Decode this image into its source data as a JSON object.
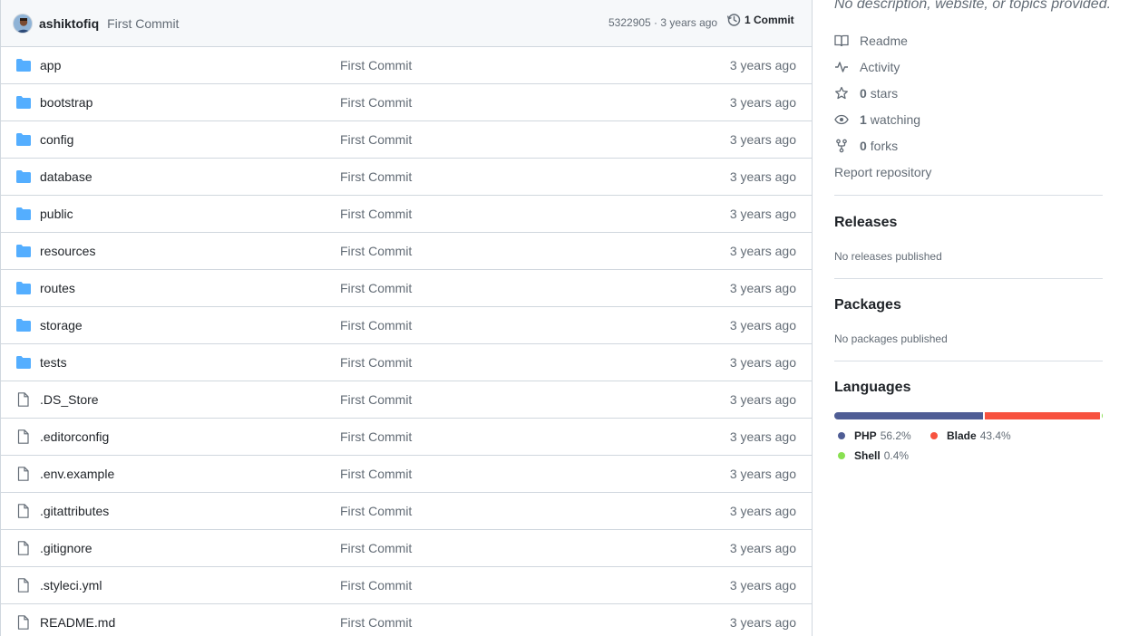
{
  "commit": {
    "author": "ashiktofiq",
    "message": "First Commit",
    "meta": "5322905 · 3 years ago",
    "count_label": "1 Commit"
  },
  "files": [
    {
      "name": "app",
      "type": "folder",
      "message": "First Commit",
      "age": "3 years ago"
    },
    {
      "name": "bootstrap",
      "type": "folder",
      "message": "First Commit",
      "age": "3 years ago"
    },
    {
      "name": "config",
      "type": "folder",
      "message": "First Commit",
      "age": "3 years ago"
    },
    {
      "name": "database",
      "type": "folder",
      "message": "First Commit",
      "age": "3 years ago"
    },
    {
      "name": "public",
      "type": "folder",
      "message": "First Commit",
      "age": "3 years ago"
    },
    {
      "name": "resources",
      "type": "folder",
      "message": "First Commit",
      "age": "3 years ago"
    },
    {
      "name": "routes",
      "type": "folder",
      "message": "First Commit",
      "age": "3 years ago"
    },
    {
      "name": "storage",
      "type": "folder",
      "message": "First Commit",
      "age": "3 years ago"
    },
    {
      "name": "tests",
      "type": "folder",
      "message": "First Commit",
      "age": "3 years ago"
    },
    {
      "name": ".DS_Store",
      "type": "file",
      "message": "First Commit",
      "age": "3 years ago"
    },
    {
      "name": ".editorconfig",
      "type": "file",
      "message": "First Commit",
      "age": "3 years ago"
    },
    {
      "name": ".env.example",
      "type": "file",
      "message": "First Commit",
      "age": "3 years ago"
    },
    {
      "name": ".gitattributes",
      "type": "file",
      "message": "First Commit",
      "age": "3 years ago"
    },
    {
      "name": ".gitignore",
      "type": "file",
      "message": "First Commit",
      "age": "3 years ago"
    },
    {
      "name": ".styleci.yml",
      "type": "file",
      "message": "First Commit",
      "age": "3 years ago"
    },
    {
      "name": "README.md",
      "type": "file",
      "message": "First Commit",
      "age": "3 years ago"
    }
  ],
  "about": {
    "description": "No description, website, or topics provided.",
    "readme_label": "Readme",
    "activity_label": "Activity",
    "stars_count": "0",
    "stars_label": "stars",
    "watching_count": "1",
    "watching_label": "watching",
    "forks_count": "0",
    "forks_label": "forks",
    "report_label": "Report repository"
  },
  "releases": {
    "title": "Releases",
    "note": "No releases published"
  },
  "packages": {
    "title": "Packages",
    "note": "No packages published"
  },
  "languages": {
    "title": "Languages",
    "items": [
      {
        "name": "PHP",
        "percent": "56.2%",
        "value": 56.2,
        "color": "#4F5D95"
      },
      {
        "name": "Blade",
        "percent": "43.4%",
        "value": 43.4,
        "color": "#f7523f"
      },
      {
        "name": "Shell",
        "percent": "0.4%",
        "value": 0.4,
        "color": "#89e051"
      }
    ]
  },
  "colors": {
    "folder": "#54aeff",
    "muted": "#636c76",
    "border": "#d0d7de"
  }
}
